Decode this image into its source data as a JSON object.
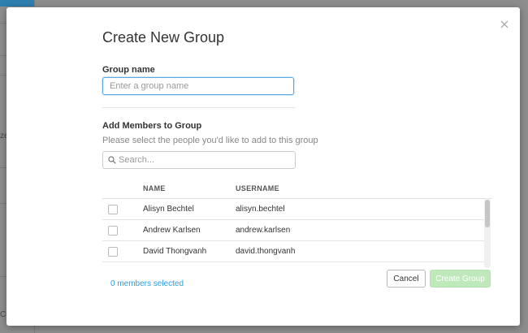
{
  "background": {
    "side_text_1": "ze",
    "side_text_2": "Co"
  },
  "modal": {
    "title": "Create New Group",
    "group_name_label": "Group name",
    "group_name_placeholder": "Enter a group name",
    "group_name_value": "",
    "members_label": "Add Members to Group",
    "members_help": "Please select the people you'd like to add to this group",
    "search_placeholder": "Search...",
    "search_value": "",
    "table": {
      "columns": [
        "NAME",
        "USERNAME"
      ],
      "rows": [
        {
          "name": "Alisyn Bechtel",
          "username": "alisyn.bechtel",
          "checked": false
        },
        {
          "name": "Andrew Karlsen",
          "username": "andrew.karlsen",
          "checked": false
        },
        {
          "name": "David Thongvanh",
          "username": "david.thongvanh",
          "checked": false
        }
      ]
    },
    "members_selected": "0 members selected",
    "cancel_label": "Cancel",
    "create_label": "Create Group",
    "create_disabled": true
  },
  "colors": {
    "accent": "#2d9be0",
    "create_disabled_bg": "#bfe9bb",
    "focus_border": "#5aa9e6"
  },
  "icons": {
    "close": "close-icon",
    "search": "search-icon"
  }
}
